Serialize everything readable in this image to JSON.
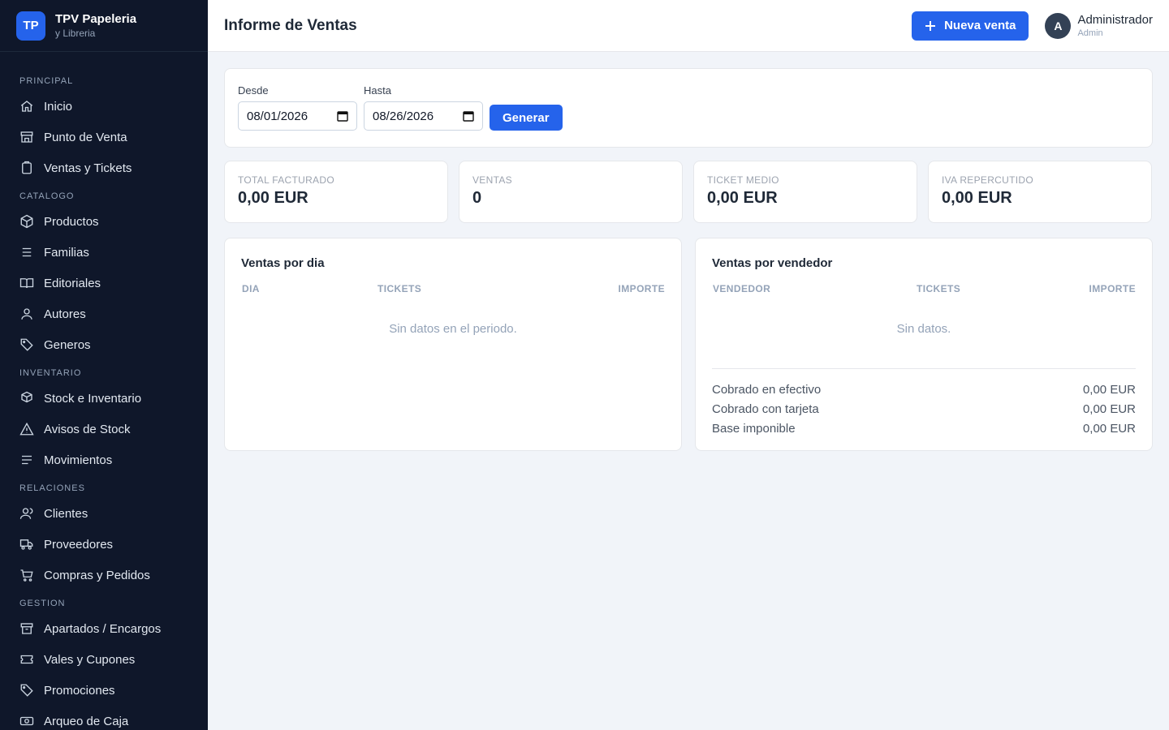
{
  "brand": {
    "logo": "TP",
    "name": "TPV Papeleria",
    "sub": "y Libreria"
  },
  "nav": {
    "sections": [
      {
        "title": "PRINCIPAL",
        "items": [
          {
            "label": "Inicio",
            "icon": "home-icon"
          },
          {
            "label": "Punto de Venta",
            "icon": "store-icon"
          },
          {
            "label": "Ventas y Tickets",
            "icon": "clipboard-icon"
          }
        ]
      },
      {
        "title": "CATALOGO",
        "items": [
          {
            "label": "Productos",
            "icon": "cube-icon"
          },
          {
            "label": "Familias",
            "icon": "list-icon"
          },
          {
            "label": "Editoriales",
            "icon": "book-icon"
          },
          {
            "label": "Autores",
            "icon": "user-icon"
          },
          {
            "label": "Generos",
            "icon": "tag-icon"
          }
        ]
      },
      {
        "title": "INVENTARIO",
        "items": [
          {
            "label": "Stock e Inventario",
            "icon": "box-icon"
          },
          {
            "label": "Avisos de Stock",
            "icon": "warning-icon"
          },
          {
            "label": "Movimientos",
            "icon": "lines-icon"
          }
        ]
      },
      {
        "title": "RELACIONES",
        "items": [
          {
            "label": "Clientes",
            "icon": "users-icon"
          },
          {
            "label": "Proveedores",
            "icon": "truck-icon"
          },
          {
            "label": "Compras y Pedidos",
            "icon": "cart-icon"
          }
        ]
      },
      {
        "title": "GESTION",
        "items": [
          {
            "label": "Apartados / Encargos",
            "icon": "archive-icon"
          },
          {
            "label": "Vales y Cupones",
            "icon": "ticket-icon"
          },
          {
            "label": "Promociones",
            "icon": "tag-icon"
          },
          {
            "label": "Arqueo de Caja",
            "icon": "cash-icon"
          }
        ]
      }
    ]
  },
  "header": {
    "title": "Informe de Ventas",
    "new_sale_label": "Nueva venta",
    "user_initial": "A",
    "user_name": "Administrador",
    "user_role": "Admin"
  },
  "filters": {
    "from_label": "Desde",
    "from_value": "08/01/2026",
    "to_label": "Hasta",
    "to_value": "08/26/2026",
    "generate_label": "Generar"
  },
  "kpis": [
    {
      "label": "TOTAL FACTURADO",
      "value": "0,00 EUR"
    },
    {
      "label": "VENTAS",
      "value": "0"
    },
    {
      "label": "TICKET MEDIO",
      "value": "0,00 EUR"
    },
    {
      "label": "IVA REPERCUTIDO",
      "value": "0,00 EUR"
    }
  ],
  "by_day": {
    "title": "Ventas por dia",
    "columns": [
      "DIA",
      "TICKETS",
      "IMPORTE"
    ],
    "empty": "Sin datos en el periodo."
  },
  "by_seller": {
    "title": "Ventas por vendedor",
    "columns": [
      "VENDEDOR",
      "TICKETS",
      "IMPORTE"
    ],
    "empty": "Sin datos.",
    "summary": [
      {
        "label": "Cobrado en efectivo",
        "value": "0,00 EUR"
      },
      {
        "label": "Cobrado con tarjeta",
        "value": "0,00 EUR"
      },
      {
        "label": "Base imponible",
        "value": "0,00 EUR"
      }
    ]
  },
  "colors": {
    "accent": "#2563eb",
    "sidebar": "#0f172a"
  }
}
